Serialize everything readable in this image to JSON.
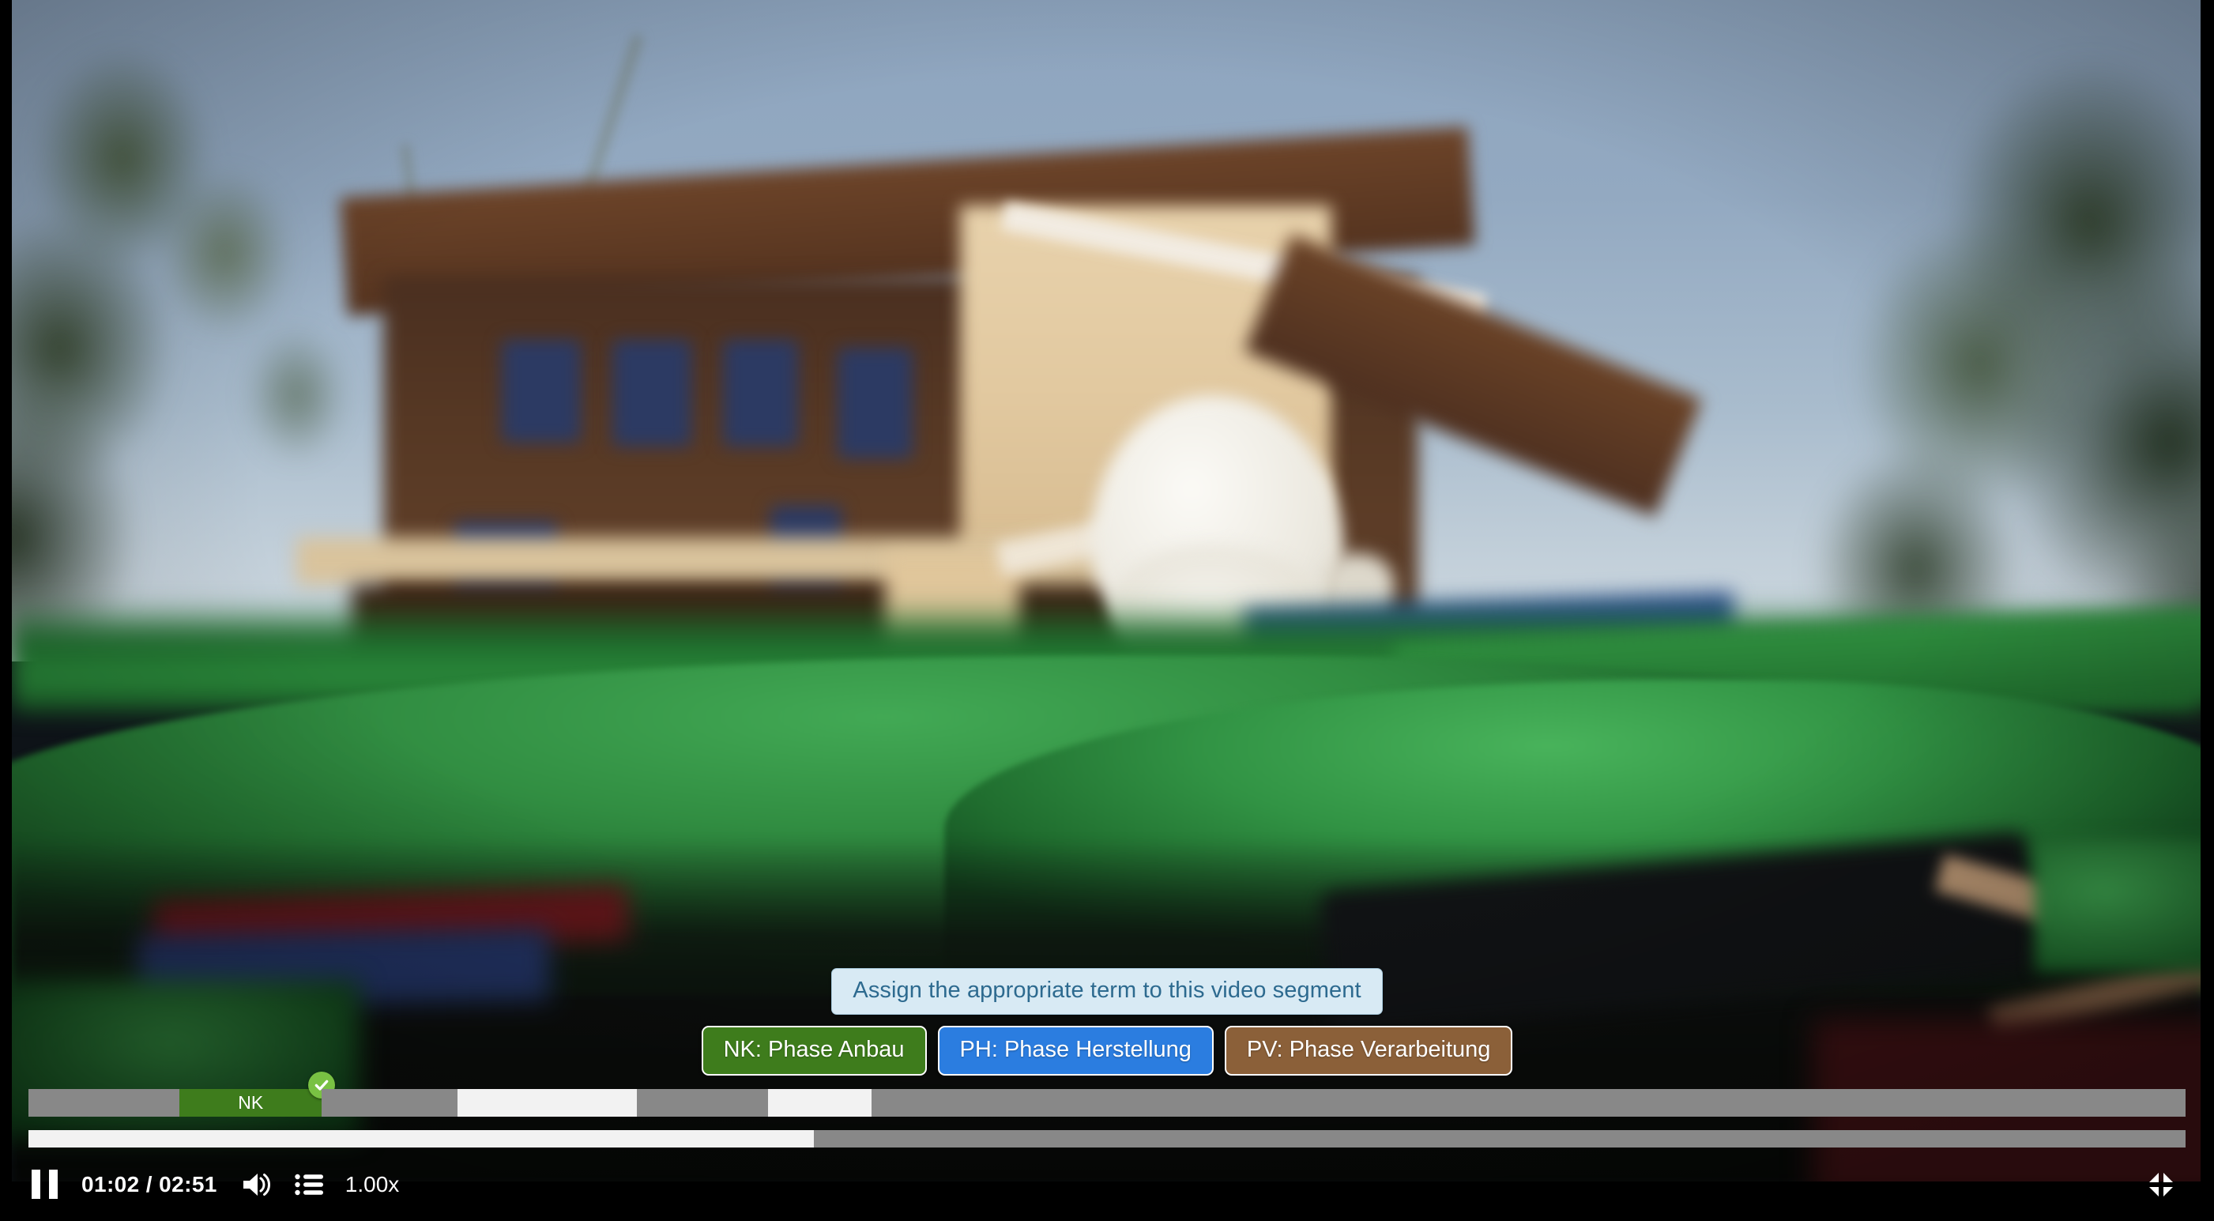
{
  "app": {
    "type": "video-annotation-player",
    "scene_description": "Blurred outdoor video frame: wooden chalet house behind green agricultural netting, person dressed in white"
  },
  "prompt": {
    "text": "Assign the appropriate term to this video segment"
  },
  "choices": [
    {
      "id": "NK",
      "label": "NK: Phase Anbau",
      "color": "#3e7c1c"
    },
    {
      "id": "PH",
      "label": "PH: Phase Herstellung",
      "color": "#2b7de0"
    },
    {
      "id": "PV",
      "label": "PV: Phase Verarbeitung",
      "color": "#8b6039"
    }
  ],
  "timeline": {
    "segments": [
      {
        "label": "",
        "state": "unlabeled",
        "color": "#888888",
        "width_pct": 7.0,
        "labeled": false
      },
      {
        "label": "NK",
        "state": "labeled",
        "color": "#3e7c1c",
        "width_pct": 6.6,
        "labeled": true
      },
      {
        "label": "",
        "state": "unlabeled",
        "color": "#888888",
        "width_pct": 6.3,
        "labeled": false
      },
      {
        "label": "",
        "state": "empty",
        "color": "#f2f2f2",
        "width_pct": 8.3,
        "labeled": false
      },
      {
        "label": "",
        "state": "unlabeled",
        "color": "#888888",
        "width_pct": 6.1,
        "labeled": false
      },
      {
        "label": "",
        "state": "empty",
        "color": "#f2f2f2",
        "width_pct": 4.8,
        "labeled": false
      },
      {
        "label": "",
        "state": "unlabeled",
        "color": "#888888",
        "width_pct": 60.9,
        "labeled": false
      }
    ],
    "checkmark_icon": "check-icon",
    "badge_color": "#79c143"
  },
  "progress": {
    "played_pct": 36.4,
    "fill_color": "#f2f2f2",
    "track_color": "#888888"
  },
  "controls": {
    "play_state": "paused",
    "pause_icon": "pause-icon",
    "current_time": "01:02",
    "separator": "/",
    "duration": "02:51",
    "time_display": "01:02 / 02:51",
    "volume_icon": "volume-high-icon",
    "playlist_icon": "playlist-list-icon",
    "playback_rate": "1.00x",
    "fullscreen_icon": "exit-fullscreen-icon"
  }
}
